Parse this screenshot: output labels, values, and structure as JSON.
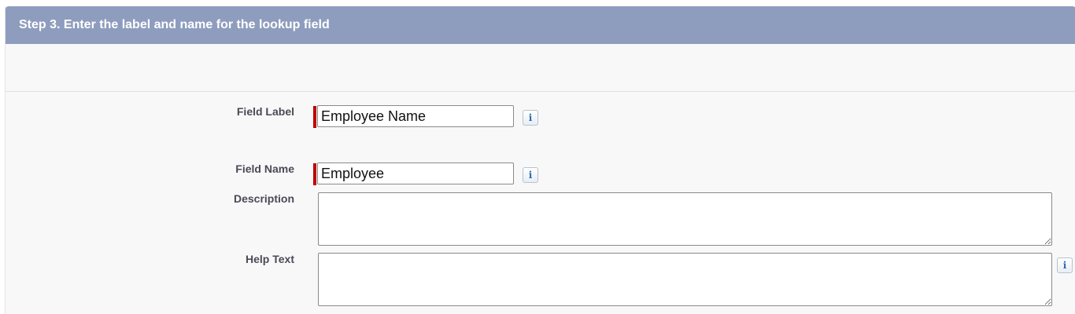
{
  "section": {
    "title": "Step 3. Enter the label and name for the lookup field"
  },
  "fields": {
    "field_label": {
      "label": "Field Label",
      "value": "Employee Name",
      "required": true,
      "info_icon": "info-icon"
    },
    "field_name": {
      "label": "Field Name",
      "value": "Employee",
      "required": true,
      "info_icon": "info-icon"
    },
    "description": {
      "label": "Description",
      "value": ""
    },
    "help_text": {
      "label": "Help Text",
      "value": "",
      "info_icon": "info-icon"
    }
  },
  "colors": {
    "header_bg": "#8e9dbe",
    "required_bar": "#c00000",
    "info_glyph": "#2a6bb0"
  },
  "icons": {
    "info_glyph": "i"
  }
}
